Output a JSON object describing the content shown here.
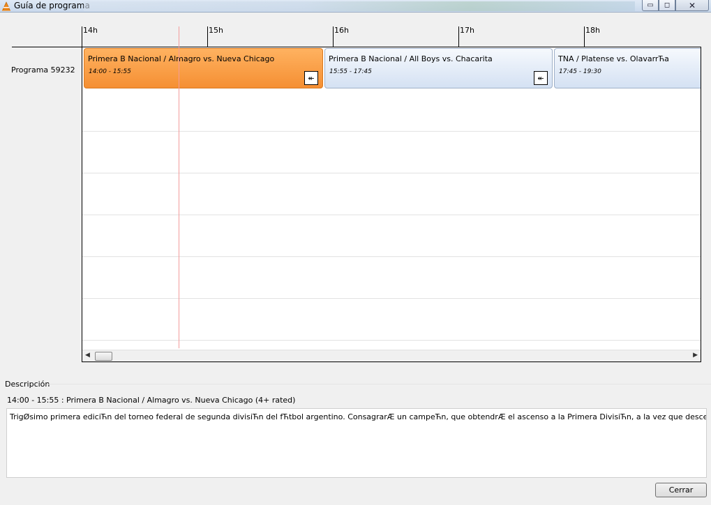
{
  "window": {
    "title": "Guía de programa",
    "controls": {
      "minimize": "▭",
      "maximize": "◻",
      "close": "✕"
    }
  },
  "timeline": {
    "ticks": [
      "14h",
      "15h",
      "16h",
      "17h",
      "18h"
    ]
  },
  "channel": {
    "label": "Programa 59232"
  },
  "programs": [
    {
      "title": "Primera B Nacional / Almagro vs. Nueva Chicago",
      "time": "14:00 - 15:55",
      "state": "current"
    },
    {
      "title": "Primera B Nacional / All Boys vs. Chacarita",
      "time": "15:55 - 17:45",
      "state": "other"
    },
    {
      "title": "TNA / Platense vs. OlavarrЋa",
      "time": "17:45 - 19:30",
      "state": "other"
    }
  ],
  "arrow_glyph": "↞",
  "description": {
    "label": "Descripción",
    "title": "14:00 - 15:55 : Primera B Nacional / Almagro vs. Nueva Chicago (4+ rated)",
    "text": "TrigØsimo primera ediciЋn del torneo federal de segunda divisiЋn del fЋtbol argentino. ConsagrarÆ un campeЋn, que obtendrÆ el ascenso a la Primera DivisiЋn, a la vez que descenderÆ un equipo por"
  },
  "buttons": {
    "close": "Cerrar"
  },
  "colors": {
    "current_program": "#f79a3e",
    "other_program": "#dfe8f5",
    "now_line": "#f29c9c"
  }
}
